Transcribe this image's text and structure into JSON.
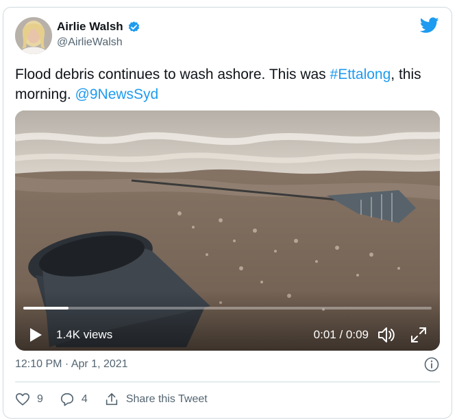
{
  "author": {
    "name": "Airlie Walsh",
    "handle": "@AirlieWalsh",
    "verified": true
  },
  "tweet": {
    "text_before": "Flood debris continues to wash ashore. This was ",
    "hashtag": "#Ettalong",
    "text_middle": ", this morning. ",
    "mention": "@9NewsSyd"
  },
  "video": {
    "views": "1.4K views",
    "time": "0:01 / 0:09",
    "progress_fraction": 0.11
  },
  "meta": {
    "timestamp": "12:10 PM · Apr 1, 2021"
  },
  "actions": {
    "likes": "9",
    "replies": "4",
    "share_label": "Share this Tweet"
  },
  "colors": {
    "link": "#1d9bf0",
    "verified": "#1d9bf0",
    "muted": "#536471",
    "border": "#cfd9de"
  },
  "icons": [
    "verified-badge-icon",
    "twitter-bird-icon",
    "play-icon",
    "volume-icon",
    "fullscreen-icon",
    "info-icon",
    "heart-icon",
    "reply-icon",
    "share-icon"
  ]
}
